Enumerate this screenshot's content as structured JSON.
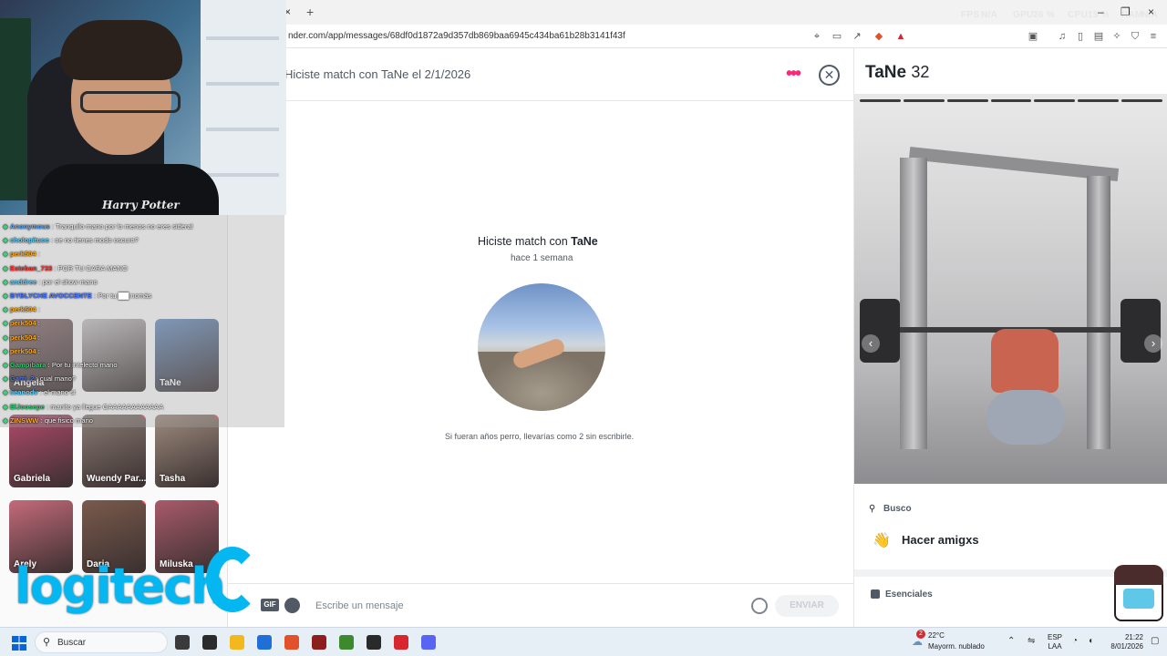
{
  "browser": {
    "tab_close": "×",
    "tab_new": "+",
    "perf": {
      "fps_label": "FPS",
      "fps_value": "N/A",
      "gpu_label": "GPU",
      "gpu_value": "26 %",
      "cpu_label": "CPU",
      "cpu_value": "15 %",
      "ram_label": "RAM",
      "ram_value": "N/A"
    },
    "window_controls": [
      "–",
      "❐",
      "×"
    ],
    "url": "nder.com/app/messages/68df0d1872a9d357db869baa6945c434ba61b28b3141f43f"
  },
  "left_pane": {
    "cards": [
      {
        "name": "Angela",
        "color": "#8b6f72",
        "dot": false
      },
      {
        "name": "",
        "color": "#c7c4c6",
        "dot": false
      },
      {
        "name": "TaNe",
        "color": "#6e93c4",
        "dot": false
      },
      {
        "name": "Gabriela",
        "color": "#b14a6b",
        "dot": false
      },
      {
        "name": "Wuendy Par...",
        "color": "#8a7b74",
        "dot": true
      },
      {
        "name": "Tasha",
        "color": "#9e8b7e",
        "dot": true
      },
      {
        "name": "Arely",
        "color": "#c46a7a",
        "dot": false
      },
      {
        "name": "Daria",
        "color": "#7a5a4c",
        "dot": true
      },
      {
        "name": "Miluska",
        "color": "#a85a6a",
        "dot": true
      }
    ]
  },
  "chat": {
    "header_title": "Hiciste match con TaNe el 2/1/2026",
    "more_icon": "•••",
    "close_icon": "✕",
    "center_title_prefix": "Hiciste match con ",
    "center_title_name": "TaNe",
    "center_time": "hace 1 semana",
    "note": "Si fueran años perro, llevarías como 2 sin escribirle.",
    "gif_label": "GIF",
    "input_placeholder": "Escribe un mensaje",
    "send_label": "ENVIAR"
  },
  "profile": {
    "name": "TaNe",
    "age": "32",
    "nav_left": "‹",
    "nav_right": "›",
    "looking_label": "Busco",
    "looking_value": "Hacer amigxs",
    "wave_icon": "👋",
    "essentials_label": "Esenciales"
  },
  "stream_overlay": {
    "webcam_shirt_text": "Harry Potter",
    "chat": [
      {
        "user": "Anonymous",
        "user_color": "#5aa8ff",
        "text": ": Tranquilo mano por lo menos no eres sideral"
      },
      {
        "user": "cholopituco",
        "user_color": "#63d4ff",
        "text": ": oe no tienes modo oscuro?"
      },
      {
        "user": "perk504",
        "user_color": "#ffb020",
        "text": ":"
      },
      {
        "user": "Esteban_733",
        "user_color": "#ff3f3f",
        "text": ": POR TU CARA MANO"
      },
      {
        "user": "anddree",
        "user_color": "#63d4ff",
        "text": ": por el show mano"
      },
      {
        "user": "BYBLYCHE AVOCCENTE",
        "user_color": "#4f7bff",
        "text": ": Por tu ▇▇ nomás"
      },
      {
        "user": "perk504",
        "user_color": "#ffb020",
        "text": ":"
      },
      {
        "user": "perk504",
        "user_color": "#ffb020",
        "text": ":"
      },
      {
        "user": "perk504",
        "user_color": "#ffb020",
        "text": ":"
      },
      {
        "user": "perk504",
        "user_color": "#ffb020",
        "text": ":"
      },
      {
        "user": "Gampibara",
        "user_color": "#37d178",
        "text": ": Por tu intelecto mano"
      },
      {
        "user": "Garri_2",
        "user_color": "#4f7bff",
        "text": ": cual mano?"
      },
      {
        "user": "lieanodv",
        "user_color": "#63d4ff",
        "text": ": el mano si"
      },
      {
        "user": "ElJoosepe",
        "user_color": "#37d178",
        "text": ": manito ya llegue GAAAAAAAAAAAA"
      },
      {
        "user": "ZINSWW",
        "user_color": "#ffb020",
        "text": ": que fisico mano"
      }
    ],
    "logitech_text": "logitech"
  },
  "taskbar": {
    "search_icon": "⚲",
    "search_label": "Buscar",
    "apps": [
      {
        "name": "task-view",
        "color": "#3a3a3a"
      },
      {
        "name": "terminal",
        "color": "#2b2b2b"
      },
      {
        "name": "file-explorer",
        "color": "#f2b81c"
      },
      {
        "name": "store",
        "color": "#1f6fd6"
      },
      {
        "name": "brave",
        "color": "#e2512a"
      },
      {
        "name": "harry-potter-app",
        "color": "#8c1e1e"
      },
      {
        "name": "minecraft",
        "color": "#3d8a2e"
      },
      {
        "name": "obs",
        "color": "#2a2a2a"
      },
      {
        "name": "red-app",
        "color": "#d8262f"
      },
      {
        "name": "discord",
        "color": "#5865f2"
      }
    ],
    "weather_badge": "2",
    "weather_temp": "22°C",
    "weather_desc": "Mayorm. nublado",
    "lang_top": "ESP",
    "lang_bottom": "LAA",
    "time": "21:22",
    "date": "8/01/2026"
  }
}
